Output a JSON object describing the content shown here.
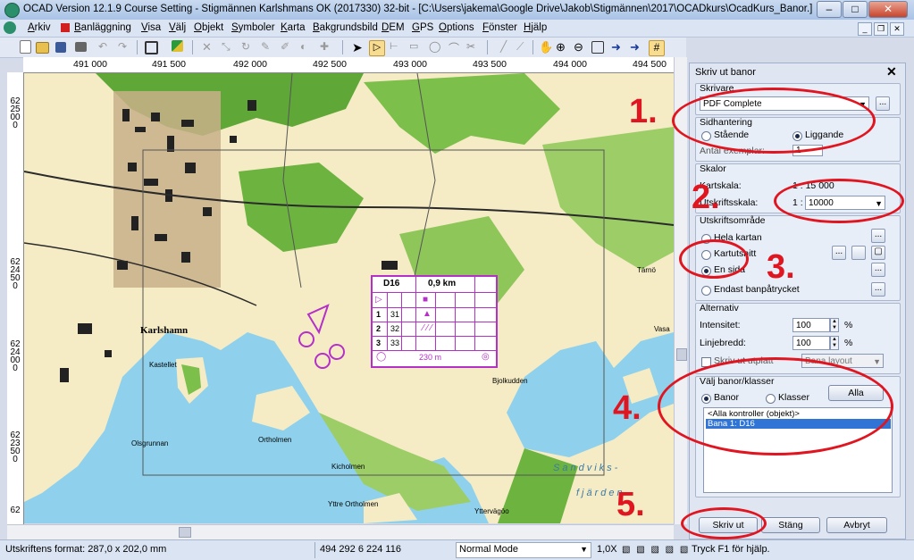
{
  "window": {
    "title": "OCAD Version 12.1.9  Course Setting - Stigmännen Karlshmans OK (2017330) 32-bit - [C:\\Users\\jakema\\Google Drive\\Jakob\\Stigmännen\\2017\\OCADkurs\\OcadKurs_Banor.]",
    "minimize": "–",
    "maximize": "□",
    "close": "✕"
  },
  "menu": [
    "Arkiv",
    "Banläggning",
    "Visa",
    "Välj",
    "Objekt",
    "Symboler",
    "Karta",
    "Bakgrundsbild",
    "DEM",
    "GPS",
    "Options",
    "Fönster",
    "Hjälp"
  ],
  "ruler": {
    "x": [
      "491 000",
      "491 500",
      "492 000",
      "492 500",
      "493 000",
      "493 500",
      "494 000",
      "494 500"
    ],
    "y": [
      "6225000",
      "6224500",
      "6224000",
      "6223500",
      "62"
    ]
  },
  "map": {
    "labels": [
      "Karlshamn",
      "Kastellet",
      "Ortholmen",
      "Olsgrunnan",
      "Kicholmen",
      "Bjolkudden",
      "Vasa",
      "Sandviks-",
      "fjärden",
      "Yttre Ortholmen",
      "Yttervägöo",
      "Tärnö"
    ],
    "control_table": {
      "header": [
        "D16",
        "0,9 km"
      ],
      "rows": [
        {
          "n": "1",
          "code": "31"
        },
        {
          "n": "2",
          "code": "32"
        },
        {
          "n": "3",
          "code": "33"
        }
      ],
      "footer": "230 m"
    }
  },
  "dialog": {
    "title": "Skriv ut banor",
    "close": "✕",
    "skrivare": {
      "label": "Skrivare",
      "value": "PDF Complete",
      "more": "..."
    },
    "sidhantering": {
      "label": "Sidhantering",
      "staende": "Stående",
      "liggande": "Liggande",
      "antal_label": "Antal exemplar:",
      "antal_value": "1"
    },
    "skalor": {
      "label": "Skalor",
      "kartskala_label": "Kartskala:",
      "kartskala_value": "1 : 15 000",
      "utskriftsskala_label": "Utskriftsskala:",
      "prefix": "1 :",
      "utskriftsskala_value": "10000"
    },
    "utskriftsomrade": {
      "label": "Utskriftsområde",
      "hela": "Hela kartan",
      "kartutsnitt": "Kartutsnitt",
      "en_sida": "En sida",
      "endast": "Endast banpåtrycket"
    },
    "alternativ": {
      "label": "Alternativ",
      "intensitet_label": "Intensitet:",
      "intensitet_value": "100",
      "linjebredd_label": "Linjebredd:",
      "linjebredd_value": "100",
      "unit": "%",
      "skriv_label": "Skriv ut utplatt",
      "layout_value": "Bana layout"
    },
    "valj": {
      "label": "Välj banor/klasser",
      "banor": "Banor",
      "klasser": "Klasser",
      "alla": "Alla",
      "items": [
        "<Alla kontroller (objekt)>",
        "Bana 1: D16"
      ]
    },
    "buttons": {
      "skriv": "Skriv ut",
      "stang": "Stäng",
      "avbryt": "Avbryt"
    }
  },
  "annotations": [
    "1.",
    "2.",
    "3.",
    "4.",
    "5."
  ],
  "status": {
    "format": "Utskriftens format: 287,0 x 202,0 mm",
    "coords": "494 292   6 224 116",
    "mode": "Normal Mode",
    "zoom": "1,0X",
    "help": "Tryck F1 för hjälp."
  },
  "colors": {
    "annotation": "#e01520",
    "selection": "#3074d6",
    "course": "#b530c8"
  }
}
